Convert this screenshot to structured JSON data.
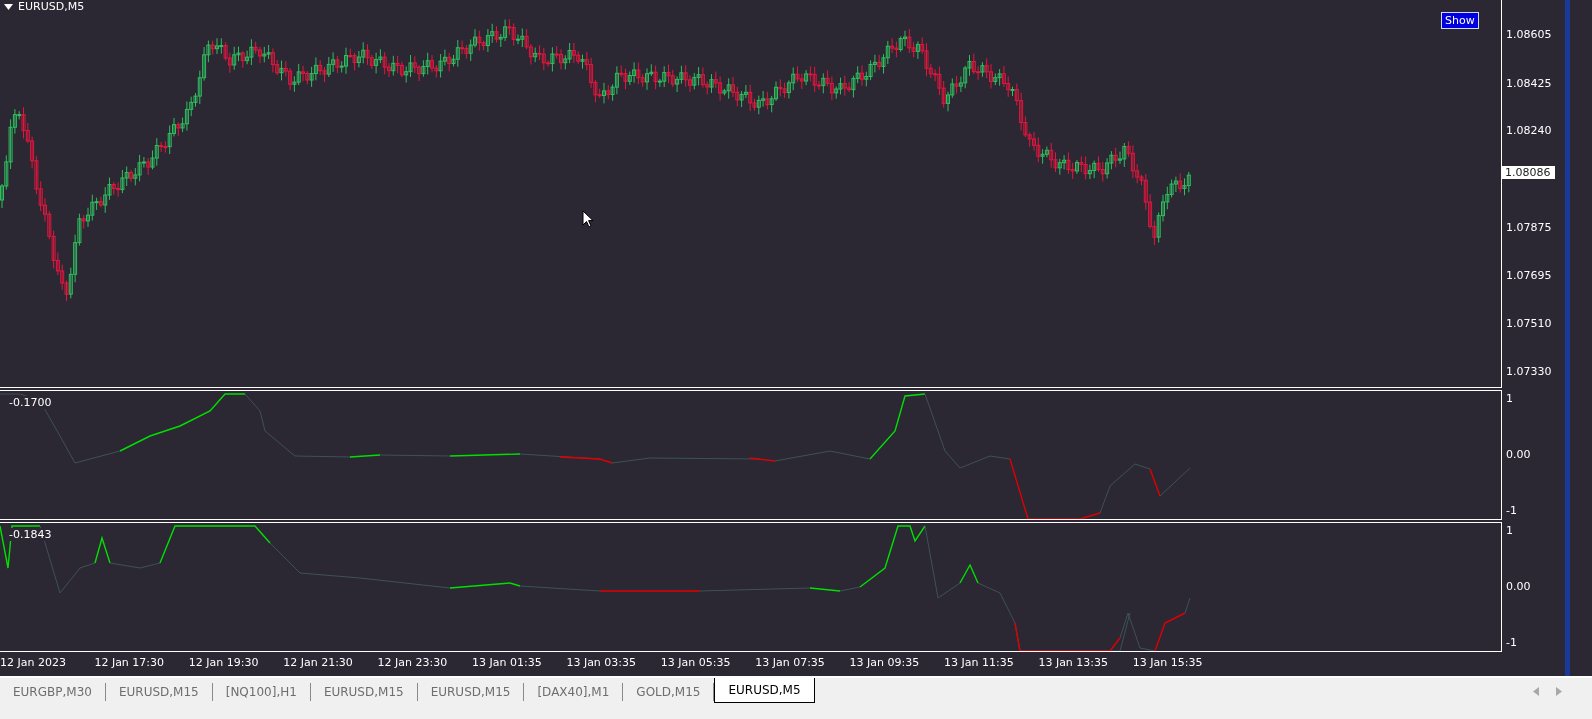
{
  "chart": {
    "title": "EURUSD,M5",
    "button": "Show",
    "bid_label": "1.08086",
    "price_labels": [
      "1.08605",
      "1.08425",
      "1.08240",
      "1.07875",
      "1.07695",
      "1.07510",
      "1.07330"
    ]
  },
  "indicators": [
    {
      "reading": "-0.1700",
      "axis_labels": [
        "1",
        "0.00",
        "-1"
      ]
    },
    {
      "reading": "-0.1843",
      "axis_labels": [
        "1",
        "0.00",
        "-1"
      ]
    }
  ],
  "time_labels": [
    "12 Jan 2023",
    "12 Jan 17:30",
    "12 Jan 19:30",
    "12 Jan 21:30",
    "12 Jan 23:30",
    "13 Jan 01:35",
    "13 Jan 03:35",
    "13 Jan 05:35",
    "13 Jan 07:35",
    "13 Jan 09:35",
    "13 Jan 11:35",
    "13 Jan 13:35",
    "13 Jan 15:35"
  ],
  "tabs": [
    {
      "label": "EURGBP,M30",
      "selected": false
    },
    {
      "label": "EURUSD,M15",
      "selected": false
    },
    {
      "label": "[NQ100],H1",
      "selected": false
    },
    {
      "label": "EURUSD,M15",
      "selected": false
    },
    {
      "label": "EURUSD,M15",
      "selected": false
    },
    {
      "label": "[DAX40],M1",
      "selected": false
    },
    {
      "label": "GOLD,M15",
      "selected": false
    },
    {
      "label": "EURUSD,M5",
      "selected": true
    }
  ]
}
